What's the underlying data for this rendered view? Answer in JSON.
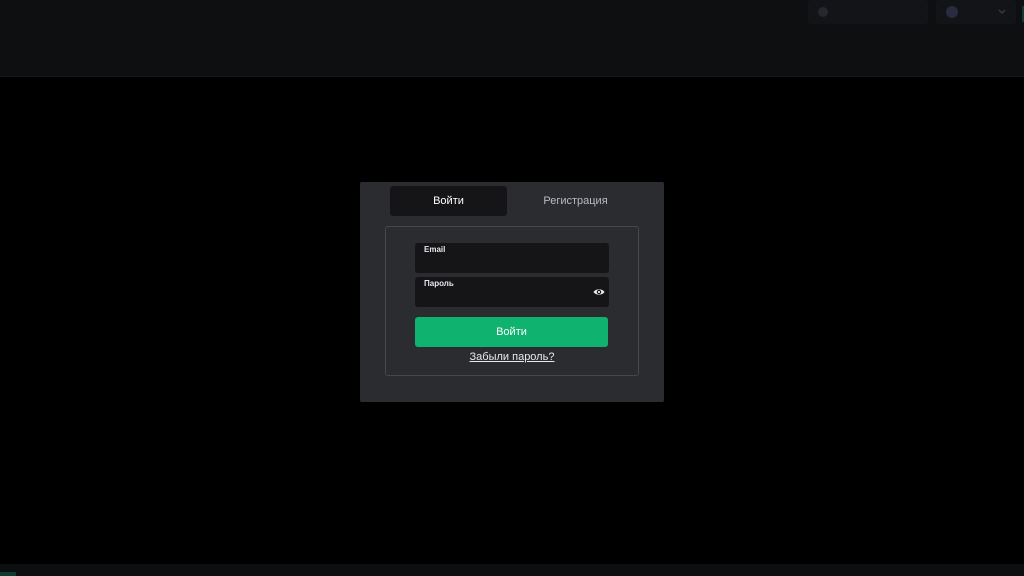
{
  "colors": {
    "background": "#000000",
    "modal_bg": "#2b2c30",
    "field_bg": "#151518",
    "primary_button": "#10b270",
    "text_primary": "#ffffff",
    "text_secondary": "#b9bbc1"
  },
  "auth_modal": {
    "tabs": [
      {
        "label": "Войти",
        "active": true
      },
      {
        "label": "Регистрация",
        "active": false
      }
    ],
    "fields": {
      "email": {
        "label": "Email",
        "value": ""
      },
      "password": {
        "label": "Пароль",
        "value": "",
        "toggle_icon": "eye-icon"
      }
    },
    "submit_label": "Войти",
    "forgot_password_label": "Забыли пароль?"
  }
}
